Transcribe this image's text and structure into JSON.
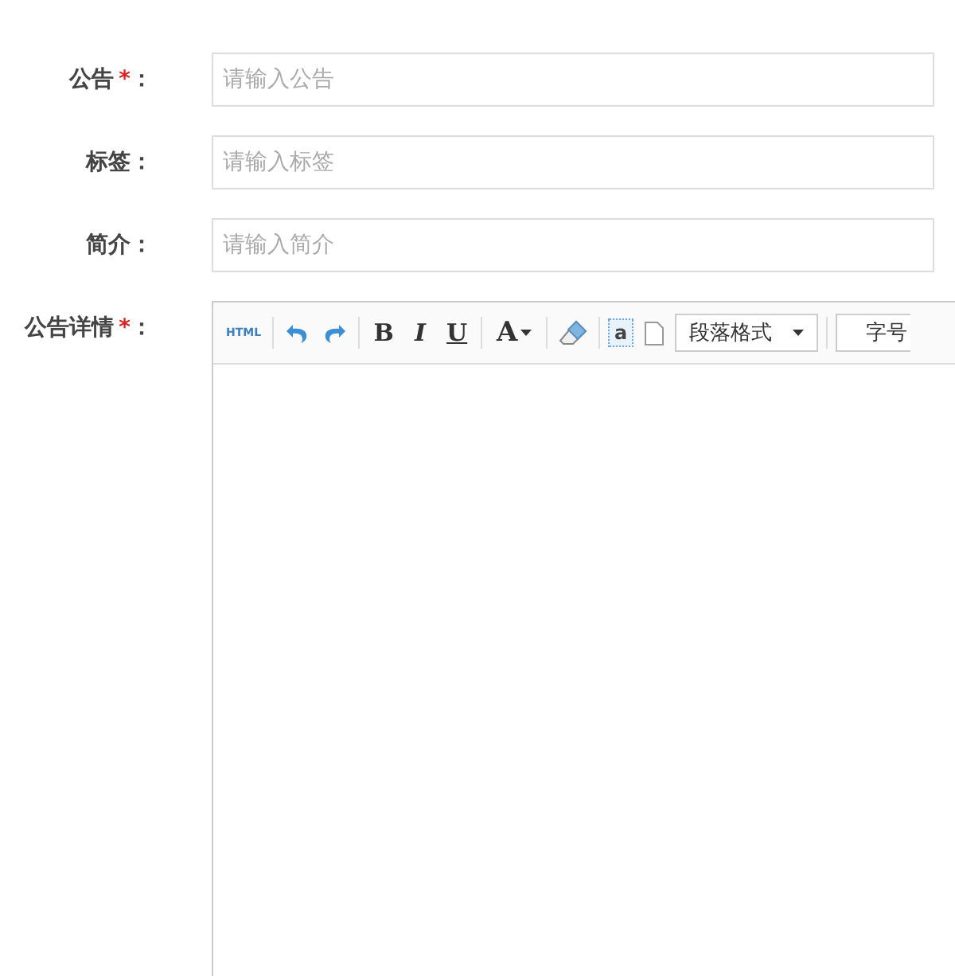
{
  "fields": [
    {
      "label": "公告",
      "required_mark": "*",
      "colon": "：",
      "placeholder": "请输入公告"
    },
    {
      "label": "标签",
      "colon": "：",
      "placeholder": "请输入标签"
    },
    {
      "label": "简介",
      "colon": "：",
      "placeholder": "请输入简介"
    }
  ],
  "editor": {
    "label": "公告详情",
    "required_mark": "*",
    "colon": "：",
    "toolbar": [
      {
        "kind": "html",
        "text": "HTML"
      },
      {
        "kind": "separator"
      },
      {
        "kind": "undo"
      },
      {
        "kind": "redo"
      },
      {
        "kind": "separator"
      },
      {
        "kind": "bold",
        "text": "B"
      },
      {
        "kind": "italic",
        "text": "I"
      },
      {
        "kind": "underline",
        "text": "U"
      },
      {
        "kind": "separator"
      },
      {
        "kind": "fontcolor",
        "text": "A"
      },
      {
        "kind": "separator"
      },
      {
        "kind": "eraser"
      },
      {
        "kind": "separator"
      },
      {
        "kind": "anchor",
        "text": "a"
      },
      {
        "kind": "page"
      },
      {
        "kind": "select",
        "text": "段落格式"
      },
      {
        "kind": "separator"
      },
      {
        "kind": "select-cut",
        "text": "字号"
      }
    ]
  }
}
